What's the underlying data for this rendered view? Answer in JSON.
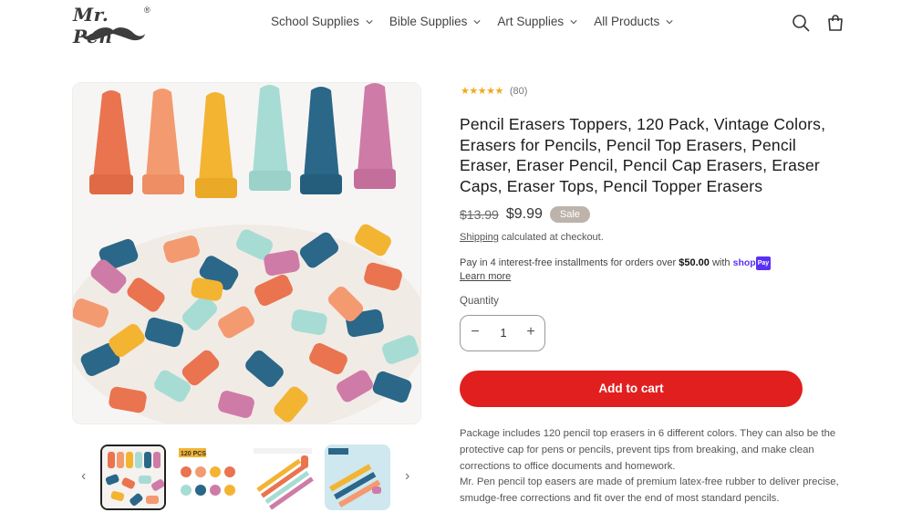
{
  "header": {
    "logo_text": "Mr. Pen",
    "logo_reg": "®",
    "nav": [
      {
        "label": "School Supplies"
      },
      {
        "label": "Bible Supplies"
      },
      {
        "label": "Art Supplies"
      },
      {
        "label": "All Products"
      }
    ],
    "icons": [
      "search-icon",
      "cart-icon"
    ]
  },
  "product": {
    "stars": "★★★★★",
    "rating_count": "(80)",
    "title": "Pencil Erasers Toppers, 120 Pack, Vintage Colors, Erasers for Pencils, Pencil Top Erasers, Pencil Eraser, Eraser Pencil, Pencil Cap Erasers, Eraser Caps, Eraser Tops, Pencil Topper Erasers",
    "old_price": "$13.99",
    "price": "$9.99",
    "sale_badge": "Sale",
    "shipping_link": "Shipping",
    "shipping_text": " calculated at checkout.",
    "pay_text_1": "Pay in 4 interest-free installments for orders over ",
    "pay_amount": "$50.00",
    "pay_text_2": " with ",
    "shop_brand": "shop",
    "shop_pay": "Pay",
    "learn_more": "Learn more",
    "quantity_label": "Quantity",
    "quantity_value": "1",
    "qty_minus": "−",
    "qty_plus": "+",
    "add_to_cart": "Add to cart",
    "description_1": "Package includes 120 pencil top erasers in 6 different colors. They can also be the protective cap for pens or pencils, prevent tips from breaking, and make clean corrections to office documents and homework.",
    "description_2": "Mr. Pen pencil top easers are made of premium latex-free rubber to deliver precise, smudge-free corrections and fit over the end of most standard pencils."
  },
  "gallery": {
    "prev": "‹",
    "next": "›",
    "thumb2_badge": "120 PCS"
  },
  "colors": {
    "accent_red": "#e21f1f",
    "star": "#f2a81d",
    "sale_badge": "#bdb3ab",
    "shop_pay": "#5a31f4"
  }
}
